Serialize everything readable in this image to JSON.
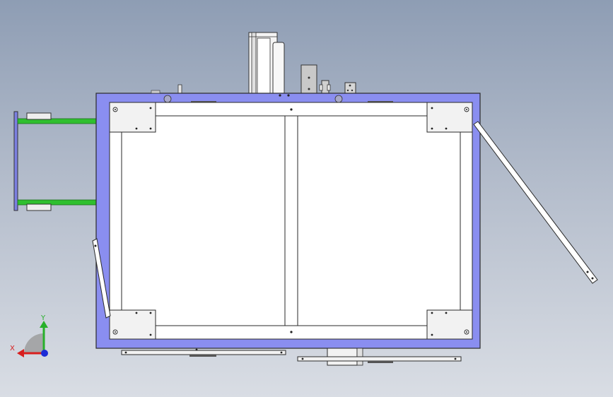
{
  "triad": {
    "x_label": "X",
    "y_label": "Y",
    "colors": {
      "x": "#d81e1e",
      "y": "#27b02a",
      "z": "#1c2bd6"
    }
  },
  "colors": {
    "frame": "#8a8ef0",
    "outline": "#2a2a2a",
    "panel": "#ffffff",
    "arm": "#2fbf2f"
  }
}
